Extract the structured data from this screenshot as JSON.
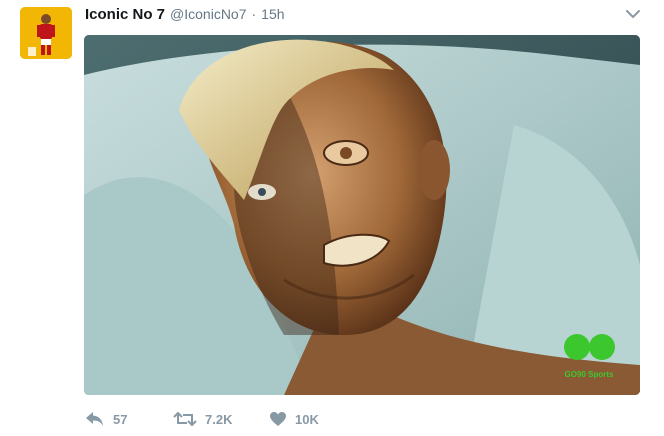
{
  "tweet": {
    "display_name": "Iconic No 7",
    "handle": "@IconicNo7",
    "separator": "·",
    "time": "15h",
    "avatar_icon": "footballer-avatar-icon",
    "menu_icon": "chevron-down-icon",
    "media": {
      "watermark": "GO90 Sports",
      "watermark_color": "#3cc72f"
    },
    "actions": {
      "reply_count": "57",
      "retweet_count": "7.2K",
      "like_count": "10K"
    }
  },
  "colors": {
    "name": "#14171a",
    "muted": "#657786",
    "action_icon": "#8899a6",
    "avatar_bg": "#f2b705"
  }
}
